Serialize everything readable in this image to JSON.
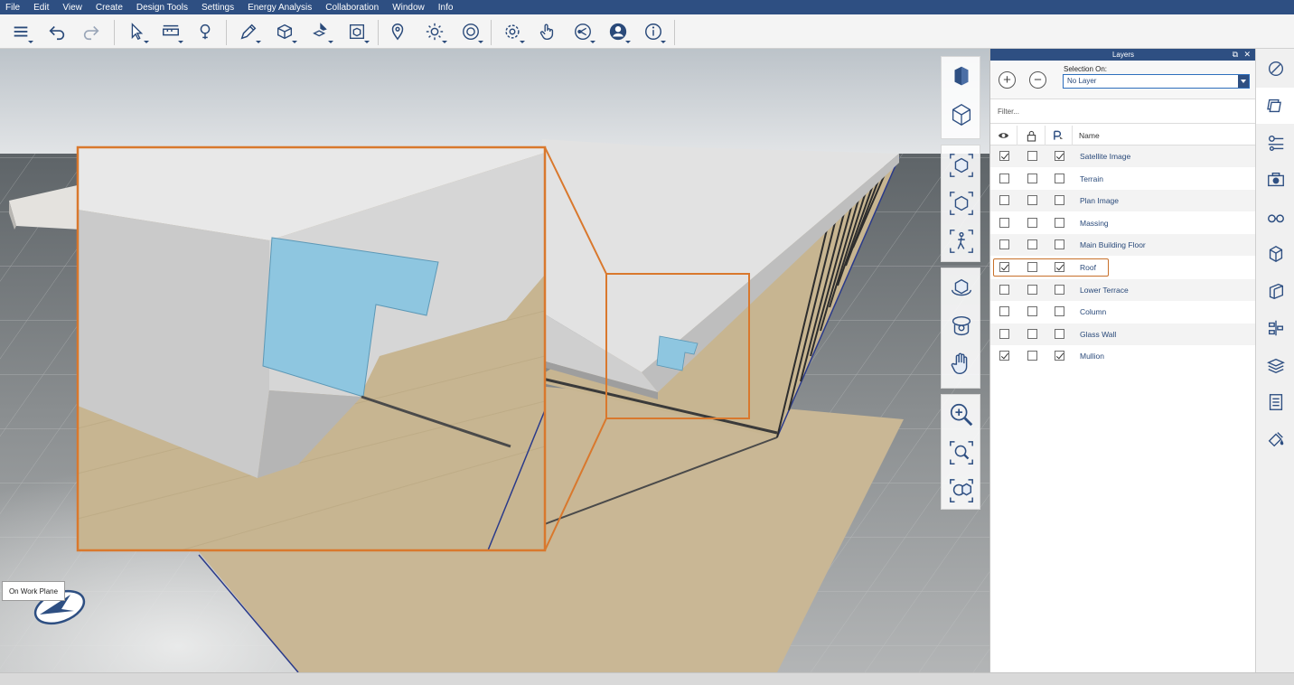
{
  "menu": [
    "File",
    "Edit",
    "View",
    "Create",
    "Design Tools",
    "Settings",
    "Energy Analysis",
    "Collaboration",
    "Window",
    "Info"
  ],
  "toolbar": {
    "icons": [
      "layers-stack-icon",
      "undo-icon",
      "redo-icon",
      "select-arrow-icon",
      "dimension-icon",
      "light-bulb-icon",
      "sketch-pencil-icon",
      "cube-add-icon",
      "modify-tool-icon",
      "section-box-icon",
      "location-pin-icon",
      "sun-icon",
      "steering-wheel-icon",
      "settings-gear-icon",
      "touch-hand-icon",
      "share-icon",
      "user-icon",
      "info-icon"
    ]
  },
  "viewport": {
    "tooltip": "On Work Plane",
    "accent_color": "#d9782d",
    "highlight_color": "#8ec6e0"
  },
  "nav": {
    "icons": [
      "view-cube-icon",
      "perspective-icon",
      "fit-view-icon",
      "home-view-icon",
      "walk-view-icon",
      "orbit-icon",
      "look-around-icon",
      "pan-hand-icon",
      "zoom-in-icon",
      "zoom-window-icon",
      "zoom-fit-icon"
    ]
  },
  "layers": {
    "title": "Layers",
    "selection_label": "Selection On:",
    "selection_value": "No Layer",
    "filter_placeholder": "Filter...",
    "name_header": "Name",
    "rows": [
      {
        "name": "Satellite Image",
        "visible": true,
        "locked": false,
        "selectable": true
      },
      {
        "name": "Terrain",
        "visible": false,
        "locked": false,
        "selectable": false
      },
      {
        "name": "Plan Image",
        "visible": false,
        "locked": false,
        "selectable": false
      },
      {
        "name": "Massing",
        "visible": false,
        "locked": false,
        "selectable": false
      },
      {
        "name": "Main Building Floor",
        "visible": false,
        "locked": false,
        "selectable": false
      },
      {
        "name": "Roof",
        "visible": true,
        "locked": false,
        "selectable": true
      },
      {
        "name": "Lower Terrace",
        "visible": false,
        "locked": false,
        "selectable": false
      },
      {
        "name": "Column",
        "visible": false,
        "locked": false,
        "selectable": false
      },
      {
        "name": "Glass Wall",
        "visible": false,
        "locked": false,
        "selectable": false
      },
      {
        "name": "Mullion",
        "visible": true,
        "locked": false,
        "selectable": true
      }
    ]
  },
  "palette": {
    "icons": [
      "materials-icon",
      "layers-icon",
      "properties-icon",
      "scenes-icon",
      "styles-icon",
      "components-icon",
      "section-icon",
      "structure-icon",
      "stack-icon",
      "checklist-icon",
      "paint-icon"
    ]
  }
}
